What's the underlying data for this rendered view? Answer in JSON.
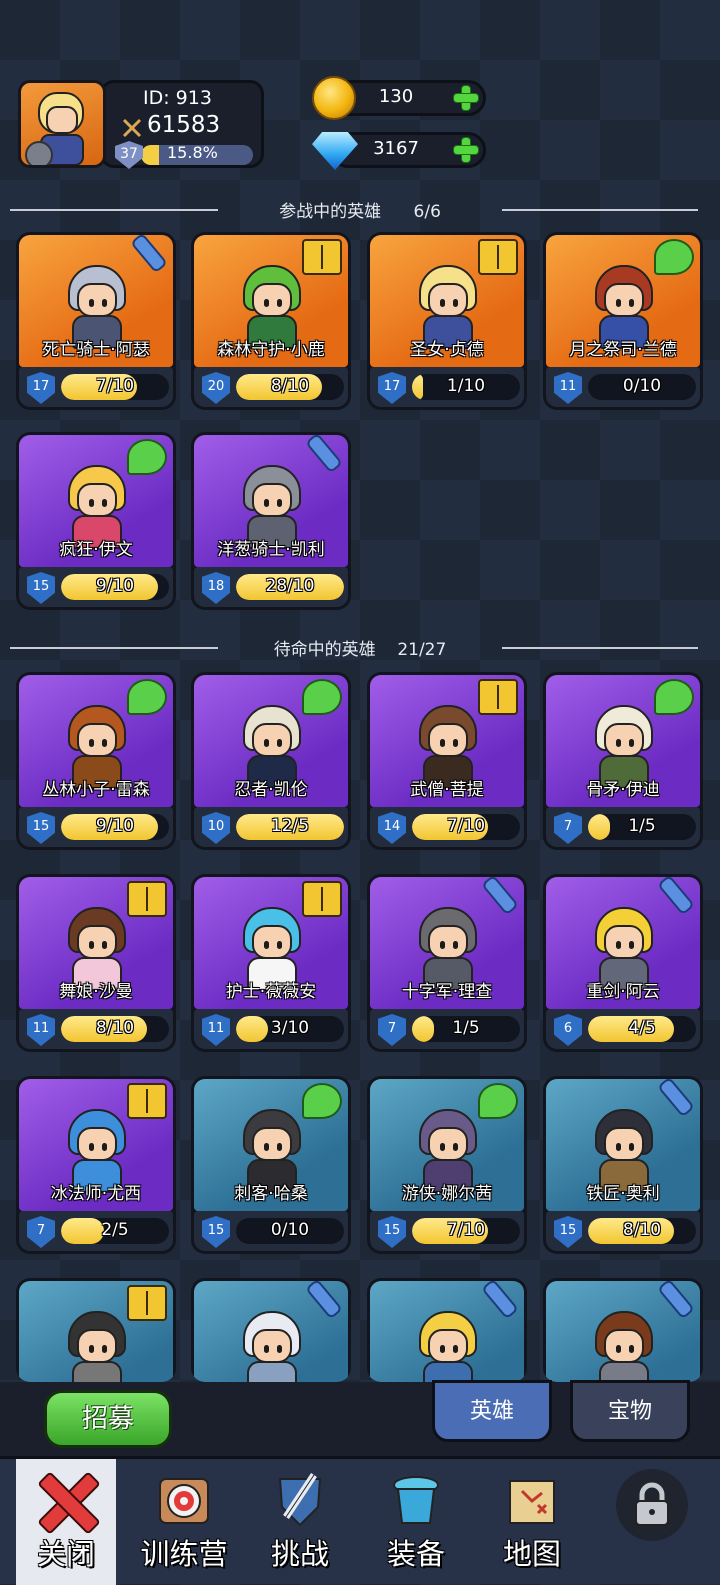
{
  "player": {
    "id_label": "ID: 913",
    "power": "61583",
    "level": "37",
    "exp_percent": "15.8%",
    "exp_fraction": 0.158
  },
  "currency": {
    "gold": "130",
    "gems": "3167"
  },
  "active_section": {
    "title": "参战中的英雄",
    "count": "6/6"
  },
  "reserve_section": {
    "title": "待命中的英雄",
    "count": "21/27"
  },
  "active_heroes": [
    {
      "name": "死亡骑士·阿瑟",
      "level": "17",
      "shards": "7/10",
      "progress": 0.7,
      "rarity": "orange",
      "badge": "sword",
      "hair": "#b8bfd0",
      "body": "#4b5573"
    },
    {
      "name": "森林守护·小鹿",
      "level": "20",
      "shards": "8/10",
      "progress": 0.8,
      "rarity": "orange",
      "badge": "book",
      "hair": "#5fbf3d",
      "body": "#2f7a3c"
    },
    {
      "name": "圣女·贞德",
      "level": "17",
      "shards": "1/10",
      "progress": 0.1,
      "rarity": "orange",
      "badge": "book",
      "hair": "#f6e08a",
      "body": "#3e4f9b"
    },
    {
      "name": "月之祭司·兰德",
      "level": "11",
      "shards": "0/10",
      "progress": 0.0,
      "rarity": "orange",
      "badge": "wing",
      "hair": "#a83a24",
      "body": "#3550a6"
    },
    {
      "name": "疯狂·伊文",
      "level": "15",
      "shards": "9/10",
      "progress": 0.9,
      "rarity": "purple",
      "badge": "wing",
      "hair": "#f7c84a",
      "body": "#d9476a"
    },
    {
      "name": "洋葱骑士·凯利",
      "level": "18",
      "shards": "28/10",
      "progress": 1.0,
      "rarity": "purple",
      "badge": "sword",
      "hair": "#8b8f99",
      "body": "#5e6270"
    }
  ],
  "reserve_heroes": [
    {
      "name": "丛林小子·雷森",
      "level": "15",
      "shards": "9/10",
      "progress": 0.9,
      "rarity": "purple",
      "badge": "wing",
      "hair": "#b4581f",
      "body": "#8a4a1a"
    },
    {
      "name": "忍者·凯伦",
      "level": "10",
      "shards": "12/5",
      "progress": 1.0,
      "rarity": "purple",
      "badge": "wing",
      "hair": "#e8e3d0",
      "body": "#1e2a48"
    },
    {
      "name": "武僧·菩提",
      "level": "14",
      "shards": "7/10",
      "progress": 0.7,
      "rarity": "purple",
      "badge": "book",
      "hair": "#7a4a2e",
      "body": "#3a2a20"
    },
    {
      "name": "骨矛·伊迪",
      "level": "7",
      "shards": "1/5",
      "progress": 0.2,
      "rarity": "purple",
      "badge": "wing",
      "hair": "#f0ead8",
      "body": "#4f6b3a"
    },
    {
      "name": "舞娘·沙曼",
      "level": "11",
      "shards": "8/10",
      "progress": 0.8,
      "rarity": "purple",
      "badge": "book",
      "hair": "#6b3a22",
      "body": "#f1c7d9"
    },
    {
      "name": "护士·薇薇安",
      "level": "11",
      "shards": "3/10",
      "progress": 0.3,
      "rarity": "purple",
      "badge": "book",
      "hair": "#4ac0e8",
      "body": "#f6f6f6"
    },
    {
      "name": "十字军·理查",
      "level": "7",
      "shards": "1/5",
      "progress": 0.2,
      "rarity": "purple",
      "badge": "sword",
      "hair": "#6a6a6f",
      "body": "#555a66"
    },
    {
      "name": "重剑·阿云",
      "level": "6",
      "shards": "4/5",
      "progress": 0.8,
      "rarity": "purple",
      "badge": "sword",
      "hair": "#f4cf35",
      "body": "#62687a"
    },
    {
      "name": "冰法师·尤西",
      "level": "7",
      "shards": "2/5",
      "progress": 0.4,
      "rarity": "purple",
      "badge": "book",
      "hair": "#3d8fdc",
      "body": "#3d8fdc"
    },
    {
      "name": "刺客·哈桑",
      "level": "15",
      "shards": "0/10",
      "progress": 0.0,
      "rarity": "teal",
      "badge": "wing",
      "hair": "#3b3b40",
      "body": "#2b2b30"
    },
    {
      "name": "游侠·娜尔茜",
      "level": "15",
      "shards": "7/10",
      "progress": 0.7,
      "rarity": "teal",
      "badge": "wing",
      "hair": "#6a5a8a",
      "body": "#4f3f70"
    },
    {
      "name": "铁匠·奥利",
      "level": "15",
      "shards": "8/10",
      "progress": 0.8,
      "rarity": "teal",
      "badge": "sword",
      "hair": "#2f2f3a",
      "body": "#8a6a3a"
    },
    {
      "name": "",
      "level": "",
      "shards": "",
      "progress": 0,
      "rarity": "teal",
      "badge": "book",
      "hair": "#333333",
      "body": "#777777"
    },
    {
      "name": "",
      "level": "",
      "shards": "",
      "progress": 0,
      "rarity": "teal",
      "badge": "sword",
      "hair": "#e8ecf2",
      "body": "#8aa0c0"
    },
    {
      "name": "",
      "level": "",
      "shards": "",
      "progress": 0,
      "rarity": "teal",
      "badge": "sword",
      "hair": "#f4cf45",
      "body": "#3d6fb0"
    },
    {
      "name": "",
      "level": "",
      "shards": "",
      "progress": 0,
      "rarity": "teal",
      "badge": "sword",
      "hair": "#7a3a1c",
      "body": "#777c88"
    }
  ],
  "actions": {
    "recruit": "招募",
    "tab_heroes": "英雄",
    "tab_treasures": "宝物"
  },
  "nav": {
    "close": "关闭",
    "training": "训练营",
    "challenge": "挑战",
    "equipment": "装备",
    "map": "地图"
  }
}
